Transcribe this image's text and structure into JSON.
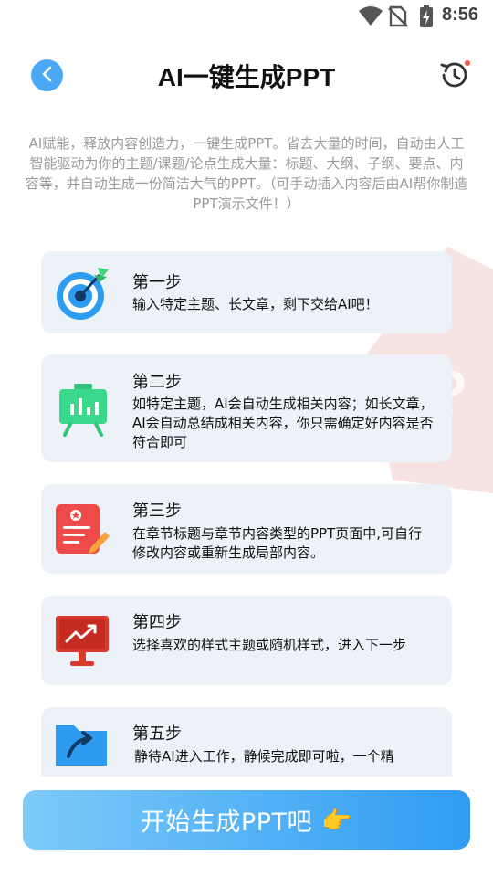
{
  "status_bar": {
    "time": "8:56"
  },
  "header": {
    "title": "AI一键生成PPT"
  },
  "description": "AI赋能，释放内容创造力，一键生成PPT。省去大量的时间，自动由人工智能驱动为你的主题/课题/论点生成大量：标题、大纲、子纲、要点、内容等，并自动生成一份简洁大气的PPT。（可手动插入内容后由AI帮你制造PPT演示文件！）",
  "steps": [
    {
      "title": "第一步",
      "desc": "输入特定主题、长文章，剩下交给AI吧！",
      "icon": "target-icon"
    },
    {
      "title": "第二步",
      "desc": "如特定主题，AI会自动生成相关内容；如长文章，AI会自动总结成相关内容，你只需确定好内容是否符合即可",
      "icon": "chart-board-icon"
    },
    {
      "title": "第三步",
      "desc": "在章节标题与章节内容类型的PPT页面中,可自行修改内容或重新生成局部内容。",
      "icon": "edit-document-icon"
    },
    {
      "title": "第四步",
      "desc": "选择喜欢的样式主题或随机样式，进入下一步",
      "icon": "monitor-trend-icon"
    },
    {
      "title": "第五步",
      "desc": "静待AI进入工作，静候完成即可啦，一个精",
      "icon": "folder-arrow-icon"
    }
  ],
  "start_button": {
    "label": "开始生成PPT吧",
    "emoji": "👉"
  },
  "colors": {
    "accent": "#4aa8f4",
    "card_bg": "#edf2f8",
    "muted_text": "#9a9a9a"
  }
}
